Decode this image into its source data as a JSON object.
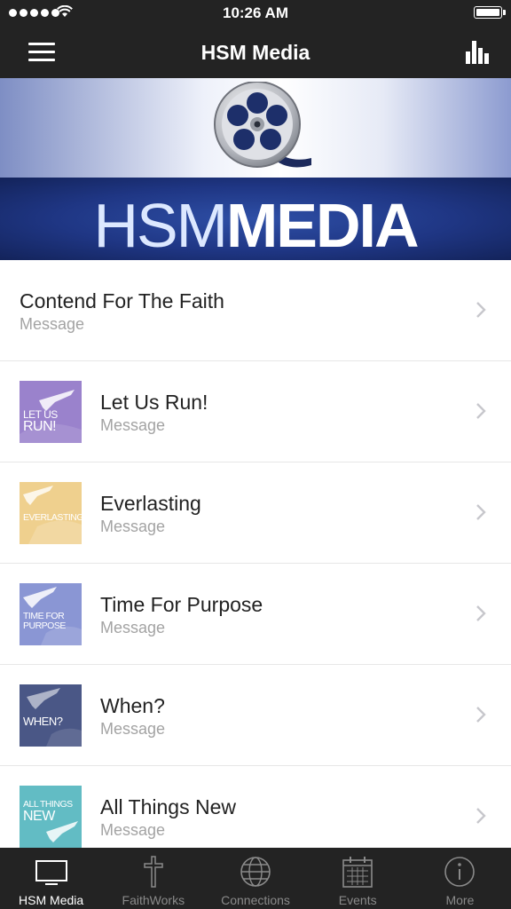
{
  "status_bar": {
    "time": "10:26 AM"
  },
  "nav": {
    "title": "HSM Media",
    "menu_icon": "hamburger-menu-icon",
    "right_icon": "bar-chart-icon"
  },
  "banner": {
    "word_light": "HSM",
    "word_bold": "MEDIA",
    "icon": "film-reel-icon"
  },
  "items": [
    {
      "title": "Contend For The Faith",
      "subtitle": "Message"
    },
    {
      "title": "Let Us Run!",
      "subtitle": "Message",
      "thumb": {
        "text_line1": "LET US",
        "text_line2": "RUN!",
        "color": "#9a82cc"
      }
    },
    {
      "title": "Everlasting",
      "subtitle": "Message",
      "thumb": {
        "text_line1": "EVERLASTING",
        "text_line2": "",
        "color": "#efd08e"
      }
    },
    {
      "title": "Time For Purpose",
      "subtitle": "Message",
      "thumb": {
        "text_line1": "TIME FOR",
        "text_line2": "PURPOSE",
        "color": "#8a96d4"
      }
    },
    {
      "title": "When?",
      "subtitle": "Message",
      "thumb": {
        "text_line1": "WHEN?",
        "text_line2": "",
        "color": "#4a5786"
      }
    },
    {
      "title": "All Things New",
      "subtitle": "Message",
      "thumb": {
        "text_line1": "ALL THINGS",
        "text_line2": "NEW",
        "color": "#62bcc4"
      }
    }
  ],
  "tabs": [
    {
      "label": "HSM Media",
      "icon": "monitor-icon",
      "active": true
    },
    {
      "label": "FaithWorks",
      "icon": "cross-icon",
      "active": false
    },
    {
      "label": "Connections",
      "icon": "globe-icon",
      "active": false
    },
    {
      "label": "Events",
      "icon": "calendar-icon",
      "active": false
    },
    {
      "label": "More",
      "icon": "info-icon",
      "active": false
    }
  ],
  "colors": {
    "bar_bg": "#232323",
    "banner_blue": "#1f3684",
    "tab_active": "#ffffff",
    "tab_inactive": "#8a8a8a"
  }
}
